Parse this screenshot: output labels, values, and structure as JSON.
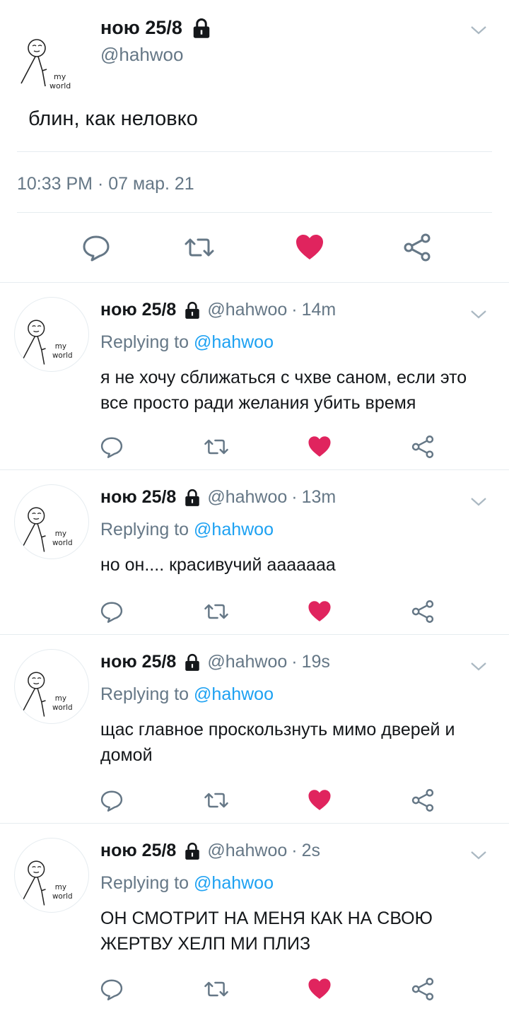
{
  "main_tweet": {
    "name": "ною 25/8",
    "handle": "@hahwoo",
    "text": "блин, как неловко",
    "timestamp": "10:33 PM · 07 мар. 21",
    "avatar_text_1": "my",
    "avatar_text_2": "world"
  },
  "replies": [
    {
      "name": "ною 25/8",
      "handle": "@hahwoo",
      "separator": "·",
      "time": "14m",
      "replying_label": "Replying to",
      "replying_to": "@hahwoo",
      "text": "я не хочу сближаться с чхве саном, если это все просто ради желания убить время"
    },
    {
      "name": "ною 25/8",
      "handle": "@hahwoo",
      "separator": "·",
      "time": "13m",
      "replying_label": "Replying to",
      "replying_to": "@hahwoo",
      "text": "но он.... красивучий ааааааа"
    },
    {
      "name": "ною 25/8",
      "handle": "@hahwoo",
      "separator": "·",
      "time": "19s",
      "replying_label": "Replying to",
      "replying_to": "@hahwoo",
      "text": "щас главное проскользнуть мимо дверей и домой"
    },
    {
      "name": "ною 25/8",
      "handle": "@hahwoo",
      "separator": "·",
      "time": "2s",
      "replying_label": "Replying to",
      "replying_to": "@hahwoo",
      "text": "ОН СМОТРИТ НА МЕНЯ КАК НА СВОЮ ЖЕРТВУ ХЕЛП МИ ПЛИЗ"
    }
  ],
  "icons": {
    "reply": "reply-icon",
    "retweet": "retweet-icon",
    "like": "heart-icon",
    "share": "share-icon",
    "lock": "lock-icon",
    "menu": "chevron-down-icon"
  },
  "colors": {
    "like_active": "#e0245e",
    "link": "#1da1f2",
    "secondary_text": "#657786",
    "divider": "#e6ecf0"
  }
}
